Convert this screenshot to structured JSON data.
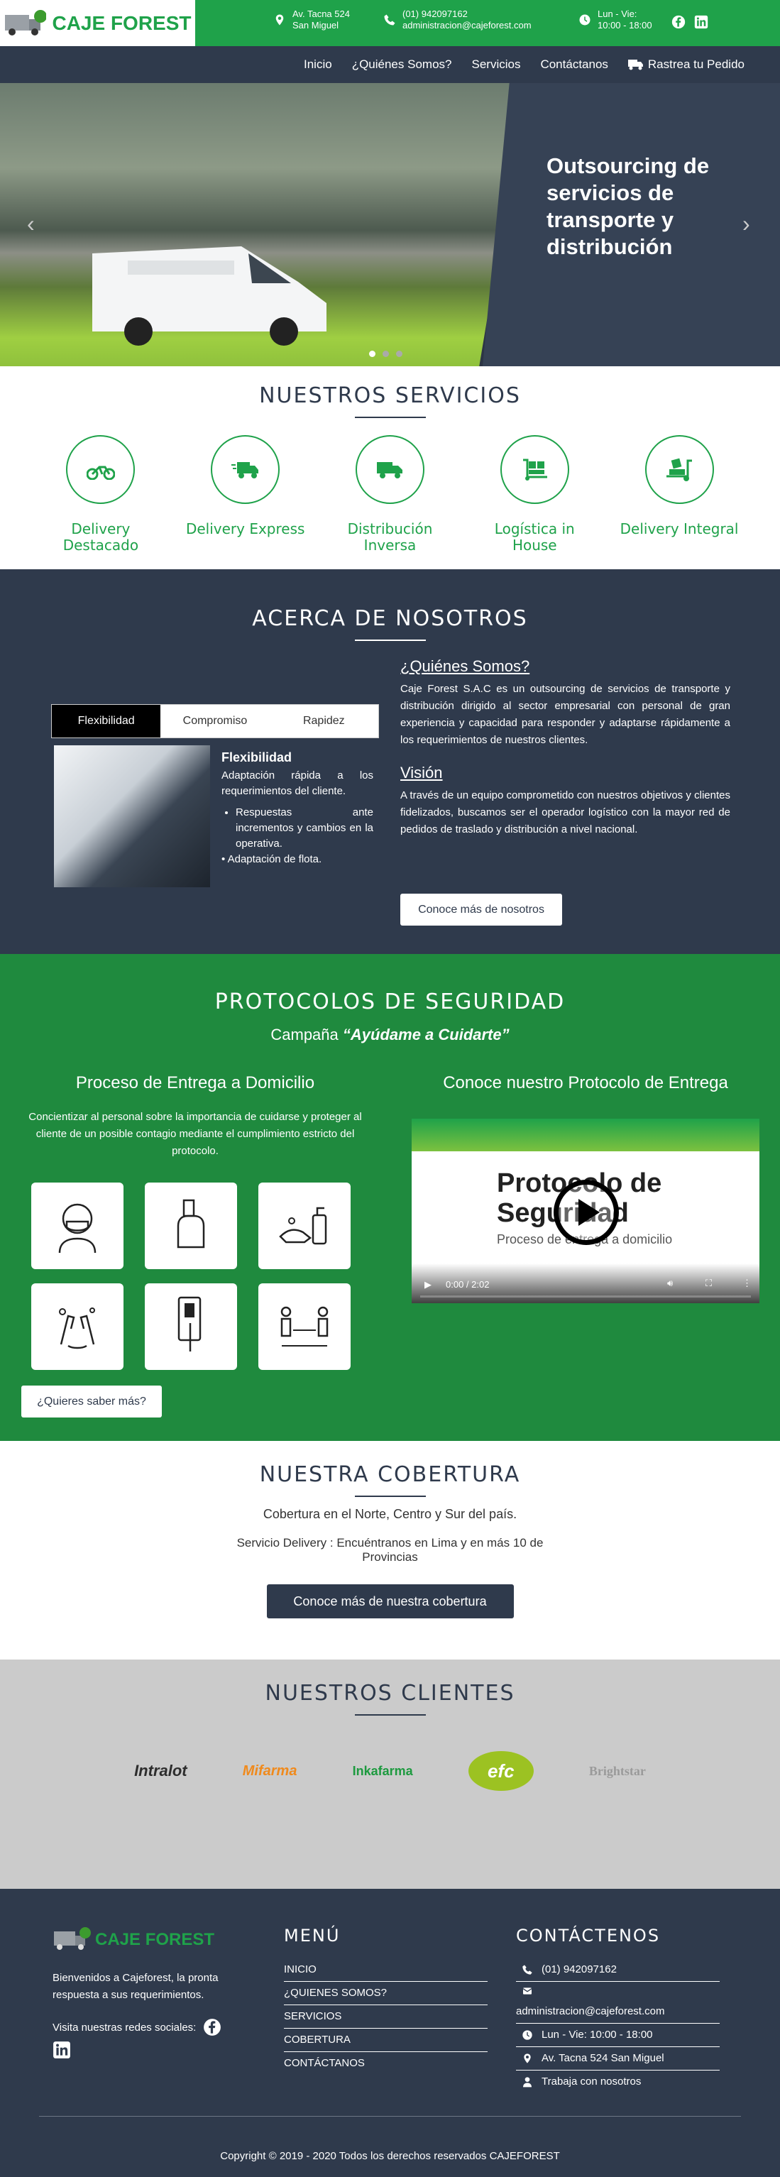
{
  "brand": {
    "logo_text": "CAJE FOREST"
  },
  "topbar": {
    "address_line1": "Av. Tacna 524",
    "address_line2": "San Miguel",
    "phone": "(01) 942097162",
    "email": "administracion@cajeforest.com",
    "hours_line1": "Lun - Vie:",
    "hours_line2": "10:00 - 18:00"
  },
  "nav": {
    "items": [
      "Inicio",
      "¿Quiénes Somos?",
      "Servicios",
      "Contáctanos",
      "Rastrea tu Pedido"
    ]
  },
  "hero": {
    "title": "Outsourcing de servicios de transporte y distribución"
  },
  "services": {
    "title": "NUESTROS SERVICIOS",
    "items": [
      "Delivery Destacado",
      "Delivery Express",
      "Distribución Inversa",
      "Logística in House",
      "Delivery Integral"
    ],
    "icons": [
      "motorcycle-icon",
      "truck-fast-icon",
      "truck-icon",
      "dolly-icon",
      "truck-loading-icon"
    ]
  },
  "about": {
    "title": "ACERCA DE NOSOTROS",
    "tabs": [
      "Flexibilidad",
      "Compromiso",
      "Rapidez"
    ],
    "flex_title": "Flexibilidad",
    "flex_text": "Adaptación rápida a los requerimientos del cliente.",
    "flex_bullet1": "Respuestas ante incrementos y cambios en la operativa.",
    "flex_bullet2": "• Adaptación de flota.",
    "who_title": "¿Quiénes Somos?",
    "who_text": "Caje Forest S.A.C es un outsourcing de servicios de transporte y distribución dirigido al sector empresarial con personal de gran experiencia y capacidad para responder y adaptarse rápidamente a los requerimientos de nuestros clientes.",
    "vision_title": "Visión",
    "vision_text": "A través de un equipo comprometido con nuestros objetivos y clientes fidelizados, buscamos ser el operador logístico con la mayor red de pedidos de traslado y distribución a nivel nacional.",
    "button": "Conoce más de nosotros"
  },
  "protocol": {
    "title": "PROTOCOLOS DE SEGURIDAD",
    "campaign_prefix": "Campaña ",
    "campaign_quote": "“Ayúdame a Cuidarte”",
    "left_title": "Proceso de Entrega a Domicilio",
    "left_text": "Concientizar al personal sobre la importancia de cuidarse y proteger al cliente de un posible contagio mediante el cumplimiento estricto del protocolo.",
    "right_title": "Conoce nuestro Protocolo de Entrega",
    "video_title": "Protocolo de Seguridad",
    "video_subtitle": "Proceso de entrega a domicilio",
    "video_time": "0:00 / 2:02",
    "button": "¿Quieres saber más?"
  },
  "coverage": {
    "title": "NUESTRA COBERTURA",
    "text1": "Cobertura en el Norte, Centro y Sur del país.",
    "text2": "Servicio Delivery : Encuéntranos en Lima y en más 10 de Provincias",
    "button": "Conoce más de nuestra cobertura"
  },
  "clients": {
    "title": "NUESTROS CLIENTES",
    "logos": [
      "Intralot",
      "Mifarma",
      "Inkafarma",
      "efc",
      "Brightstar"
    ]
  },
  "footer": {
    "welcome": "Bienvenidos a Cajeforest, la pronta respuesta a sus requerimientos.",
    "social_text": "Visita nuestras redes sociales:",
    "menu_title": "MENÚ",
    "menu": [
      "INICIO",
      "¿QUIENES SOMOS?",
      "SERVICIOS",
      "COBERTURA",
      "CONTÁCTANOS"
    ],
    "contact_title": "CONTÁCTENOS",
    "phone": "(01) 942097162",
    "email": "administracion@cajeforest.com",
    "hours": "Lun - Vie: 10:00 - 18:00",
    "address": "Av. Tacna 524 San Miguel",
    "jobs": "Trabaja con nosotros",
    "copyright": "Copyright © 2019 - 2020 Todos los derechos reservados CAJEFOREST"
  },
  "colors": {
    "green": "#1fa24a",
    "dark": "#2f3a4c"
  }
}
